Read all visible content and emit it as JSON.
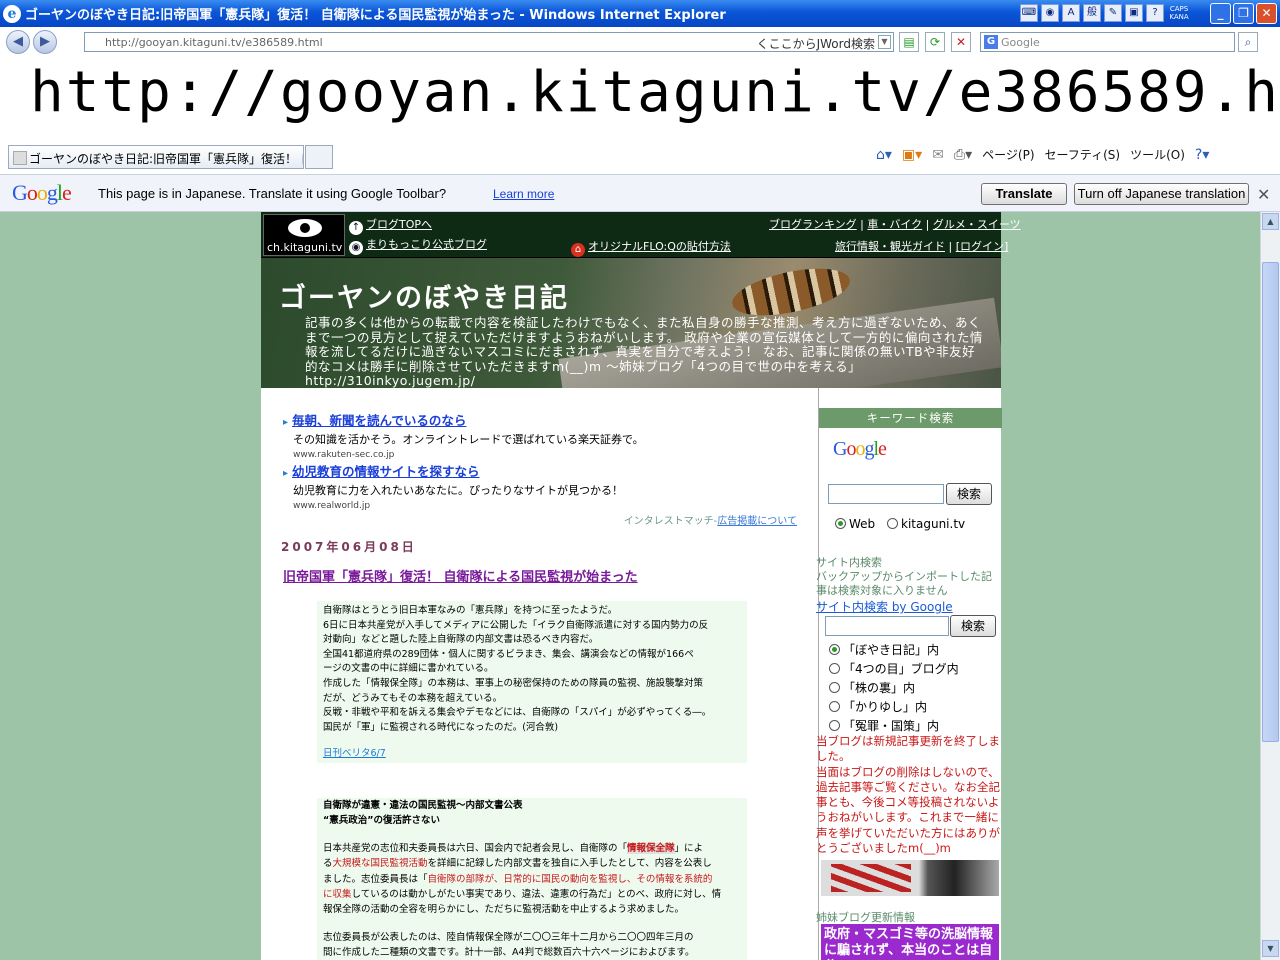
{
  "window": {
    "title": "ゴーヤンのぼやき日記:旧帝国軍「憲兵隊」復活！ 自衛隊による国民監視が始まった - Windows Internet Explorer",
    "tray": {
      "caps": "CAPS",
      "kana": "KANA",
      "ime": "般"
    }
  },
  "addressbar": {
    "url": "http://gooyan.kitaguni.tv/e386589.html",
    "jword": "くここからJWord検索",
    "search_placeholder": "Google"
  },
  "big_url": "http://gooyan.kitaguni.tv/e386589.html",
  "tab": {
    "label": "ゴーヤンのぼやき日記:旧帝国軍「憲兵隊」復活！ 自衛..."
  },
  "commandbar": {
    "page": "ページ(P)",
    "safety": "セーフティ(S)",
    "tools": "ツール(O)"
  },
  "translate": {
    "logo": "Google",
    "message": "This page is in Japanese.  Translate it using Google Toolbar?",
    "learn_more": "Learn more",
    "translate_btn": "Translate",
    "turn_off_btn": "Turn off Japanese translation"
  },
  "site": {
    "logo_text": "ch.kitaguni.tv",
    "header_links": {
      "blog_top": "ブログTOPへ",
      "marimokkori": "まりもっこり公式ブログ",
      "flo": "オリジナルFLO:Qの貼付方法",
      "ranking": "ブログランキング",
      "car": "車・バイク",
      "gourmet": "グルメ・スイーツ",
      "travel": "旅行情報・観光ガイド",
      "login": "[ログイン]",
      "sep": "|"
    },
    "blog_title": "ゴーヤンのぼやき日記",
    "blog_desc": "記事の多くは他からの転載で内容を検証したわけでもなく、また私自身の勝手な推測、考え方に過ぎないため、あくまで一つの見方として捉えていただけますようおねがいします。 政府や企業の宣伝媒体として一方的に偏向された情報を流してるだけに過ぎないマスコミにだまされず、真実を自分で考えよう！ なお、記事に関係の無いTBや非友好的なコメは勝手に削除させていただきますm(__)m 〜姉妹ブログ「4つの目で世の中を考える」http://310inkyo.jugem.jp/",
    "ads": [
      {
        "title": "毎朝、新聞を読んでいるのなら",
        "desc": "その知識を活かそう。オンライントレードで選ばれている楽天証券で。",
        "url": "www.rakuten-sec.co.jp"
      },
      {
        "title": "幼児教育の情報サイトを探すなら",
        "desc": "幼児教育に力を入れたいあなたに。ぴったりなサイトが見つかる！",
        "url": "www.realworld.jp"
      }
    ],
    "ad_note": "インタレストマッチ-",
    "ad_note_link": "広告掲載について",
    "date": "2007年06月08日",
    "entry_title": "旧帝国軍「憲兵隊」復活！ 自衛隊による国民監視が始まった",
    "box1_lines": [
      "自衛隊はとうとう旧日本軍なみの「憲兵隊」を持つに至ったようだ。",
      "6日に日本共産党が入手してメディアに公開した「イラク自衛隊派遣に対する国内勢力の反",
      "対動向」などと題した陸上自衛隊の内部文書は恐るべき内容だ。",
      "全国41都道府県の289団体・個人に関するビラまき、集会、講演会などの情報が166ペ",
      "ージの文書の中に詳細に書かれている。",
      "作成した「情報保全隊」の本務は、軍事上の秘密保持のための隊員の監視、施設襲撃対策",
      "だが、どうみてもその本務を超えている。",
      "反戦・非戦や平和を訴える集会やデモなどには、自衛隊の「スパイ」が必ずやってくる―。",
      "国民が「軍」に監視される時代になったのだ。(河合敦)"
    ],
    "box1_source": "日刊ベリタ6/7",
    "box2": {
      "heading1": "自衛隊が違憲・違法の国民監視〜内部文書公表",
      "heading2": "“憲兵政治”の復活許さない",
      "p1_a": "日本共産党の志位和夫委員長は六日、国会内で記者会見し、自衛隊の「",
      "p1_hl": "情報保全隊",
      "p1_b": "」によ",
      "p2_a": "る",
      "p2_red": "大規模な国民監視活動",
      "p2_b": "を詳細に記録した内部文書を独自に入手したとして、内容を公表し",
      "p3_a": "ました。志位委員長は「",
      "p3_red": "自衛隊の部隊が、日常的に国民の動向を監視し、その情報を系統的",
      "p4_red": "に収集",
      "p4_b": "しているのは動かしがたい事実であり、違法、違憲の行為だ」とのべ、政府に対し、情",
      "p5": "報保全隊の活動の全容を明らかにし、ただちに監視活動を中止するよう求めました。",
      "p6": "志位委員長が公表したのは、陸自情報保全隊が二〇〇三年十二月から二〇〇四年三月の",
      "p7": "間に作成した二種類の文書です。計十一部、A4判で総数百六十六ページにおよびます。"
    },
    "sidebar": {
      "keyword_search": "キーワード検索",
      "google": "Google",
      "search_btn": "検索",
      "radio_web": "Web",
      "radio_site": "kitaguni.tv",
      "site_search_text": "サイト内検索\nバックアップからインポートした記事は検索対象に入りません",
      "site_search_link": "サイト内検索 by Google",
      "radios": [
        "「ぼやき日記」内",
        "「4つの目」ブログ内",
        "「株の裏」内",
        "「かりゆし」内",
        "「冤罪・国策」内"
      ],
      "notice": "当ブログは新規記事更新を終了しました。\n当面はブログの削除はしないので、過去記事等ご覧ください。なお全記事とも、今後コメ等投稿されないようおねがいします。これまで一緒に声を挙げていただいた方にはありがとうございましたm(__)m",
      "sister": "姉妹ブログ更新情報",
      "purple_text": "政府・マスゴミ等の洗脳情報に騙されず、本当のことは自分で"
    }
  }
}
